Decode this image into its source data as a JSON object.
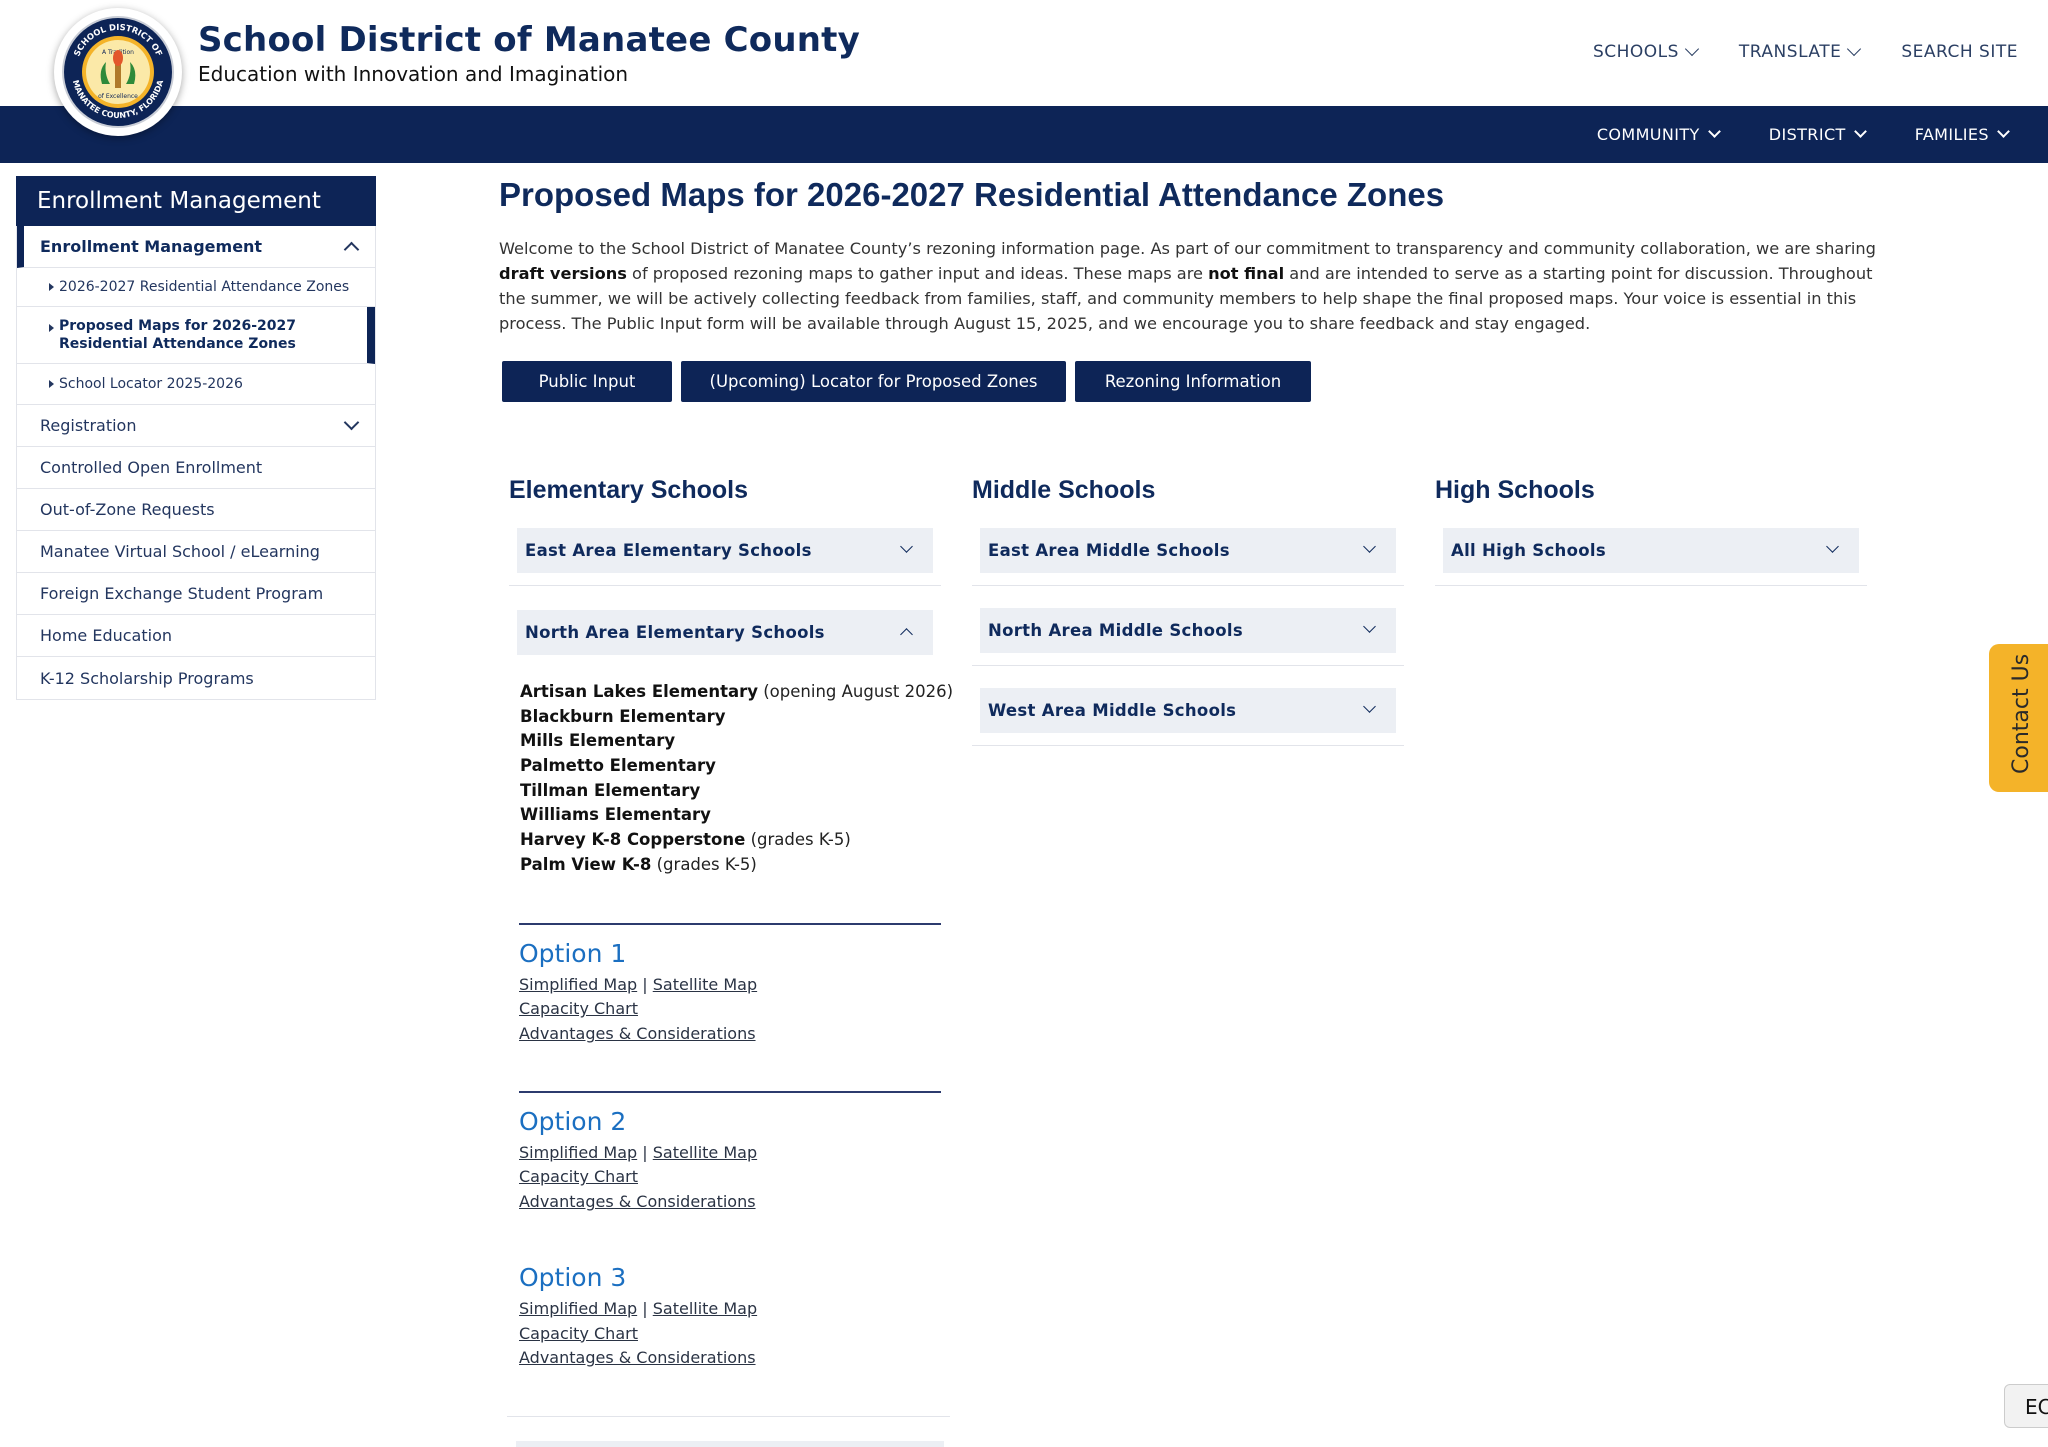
{
  "header": {
    "title": "School District of Manatee County",
    "tagline": "Education with Innovation and Imagination",
    "logo_text": [
      "SCHOOL DISTRICT OF",
      "MANATEE COUNTY, FLORIDA",
      "A Tradition",
      "of Excellence"
    ],
    "util_nav": {
      "schools": "SCHOOLS",
      "translate": "TRANSLATE",
      "search": "SEARCH SITE"
    },
    "main_nav": {
      "community": "COMMUNITY",
      "district": "DISTRICT",
      "families": "FAMILIES"
    }
  },
  "sidebar": {
    "heading": "Enrollment Management",
    "section": "Enrollment Management",
    "subitems": [
      "2026-2027 Residential Attendance Zones",
      "Proposed Maps for 2026-2027 Residential Attendance Zones",
      "School Locator 2025-2026"
    ],
    "items": [
      "Registration",
      "Controlled Open Enrollment",
      "Out-of-Zone Requests",
      "Manatee Virtual School / eLearning",
      "Foreign Exchange Student Program",
      "Home Education",
      "K-12 Scholarship Programs"
    ]
  },
  "main": {
    "title": "Proposed Maps for 2026-2027 Residential Attendance Zones",
    "intro": {
      "p1": "Welcome to the School District of Manatee County’s rezoning information page. As part of our commitment to transparency and community collaboration, we are sharing ",
      "b1": "draft versions",
      "p2": " of proposed rezoning maps to gather input and ideas. These maps are ",
      "b2": "not final",
      "p3": " and are intended to serve as a starting point for discussion. Throughout the summer, we will be actively collecting feedback from families, staff, and community members to help shape the final proposed maps. Your voice is essential in this process.  The Public Input form will be available through August 15, 2025, and we encourage you to share feedback and stay engaged."
    },
    "buttons": {
      "public_input": "Public Input",
      "locator": "(Upcoming) Locator for Proposed Zones",
      "rezoning": "Rezoning Information"
    },
    "columns": {
      "elementary": {
        "title": "Elementary Schools",
        "acc1": "East Area Elementary Schools",
        "acc2": "North Area Elementary Schools"
      },
      "middle": {
        "title": "Middle Schools",
        "acc1": "East Area Middle Schools",
        "acc2": "North Area Middle Schools",
        "acc3": "West Area Middle Schools"
      },
      "high": {
        "title": "High Schools",
        "acc1": "All High Schools"
      }
    },
    "schools": [
      {
        "name": "Artisan Lakes Elementary",
        "note": " (opening August 2026)"
      },
      {
        "name": "Blackburn Elementary",
        "note": ""
      },
      {
        "name": "Mills Elementary",
        "note": ""
      },
      {
        "name": "Palmetto Elementary",
        "note": ""
      },
      {
        "name": "Tillman Elementary",
        "note": ""
      },
      {
        "name": "Williams Elementary",
        "note": ""
      },
      {
        "name": "Harvey K-8 Copperstone",
        "note": " (grades K-5)"
      },
      {
        "name": "Palm View K-8",
        "note": " (grades K-5)"
      }
    ],
    "options": [
      {
        "title": "Option 1",
        "simplified": "Simplified Map",
        "sep": " | ",
        "satellite": "Satellite Map",
        "capacity": "Capacity Chart",
        "advantages": "Advantages & Considerations"
      },
      {
        "title": "Option 2",
        "simplified": "Simplified Map",
        "sep": " | ",
        "satellite": "Satellite Map",
        "capacity": "Capacity Chart",
        "advantages": "Advantages & Considerations"
      },
      {
        "title": "Option 3",
        "simplified": "Simplified Map",
        "sep": " | ",
        "satellite": "Satellite Map",
        "capacity": "Capacity Chart",
        "advantages": "Advantages & Considerations"
      }
    ]
  },
  "floating": {
    "contact": "Contact Us",
    "ec": "EC"
  },
  "colors": {
    "navy": "#0d2456",
    "gold": "#f4b329",
    "link_blue": "#1b6fc1",
    "accordion_bg": "#eceff4"
  }
}
